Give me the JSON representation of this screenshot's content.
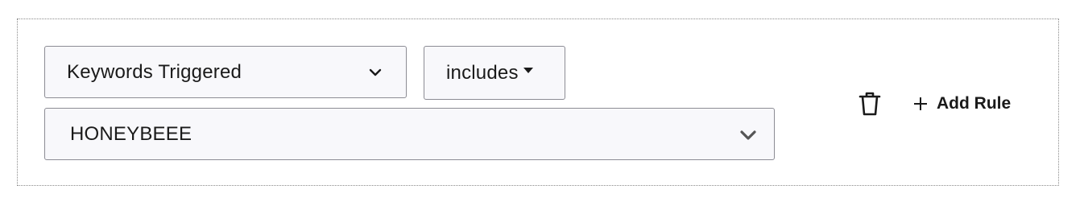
{
  "rule": {
    "field": {
      "selected": "Keywords Triggered",
      "icon": "chevron-down-icon"
    },
    "operator": {
      "selected": "includes",
      "icon": "caret-down-icon"
    },
    "value": {
      "selected": "HONEYBEEE",
      "icon": "chevron-down-icon"
    },
    "delete_icon": "trash-icon",
    "add_rule": {
      "label": "Add Rule",
      "icon": "plus-icon"
    }
  },
  "colors": {
    "select_background": "#f8f8fb",
    "select_border": "#8c8c94",
    "text": "#1a1a1a",
    "chevron": "#555555",
    "container_border": "#8a8a8a"
  }
}
